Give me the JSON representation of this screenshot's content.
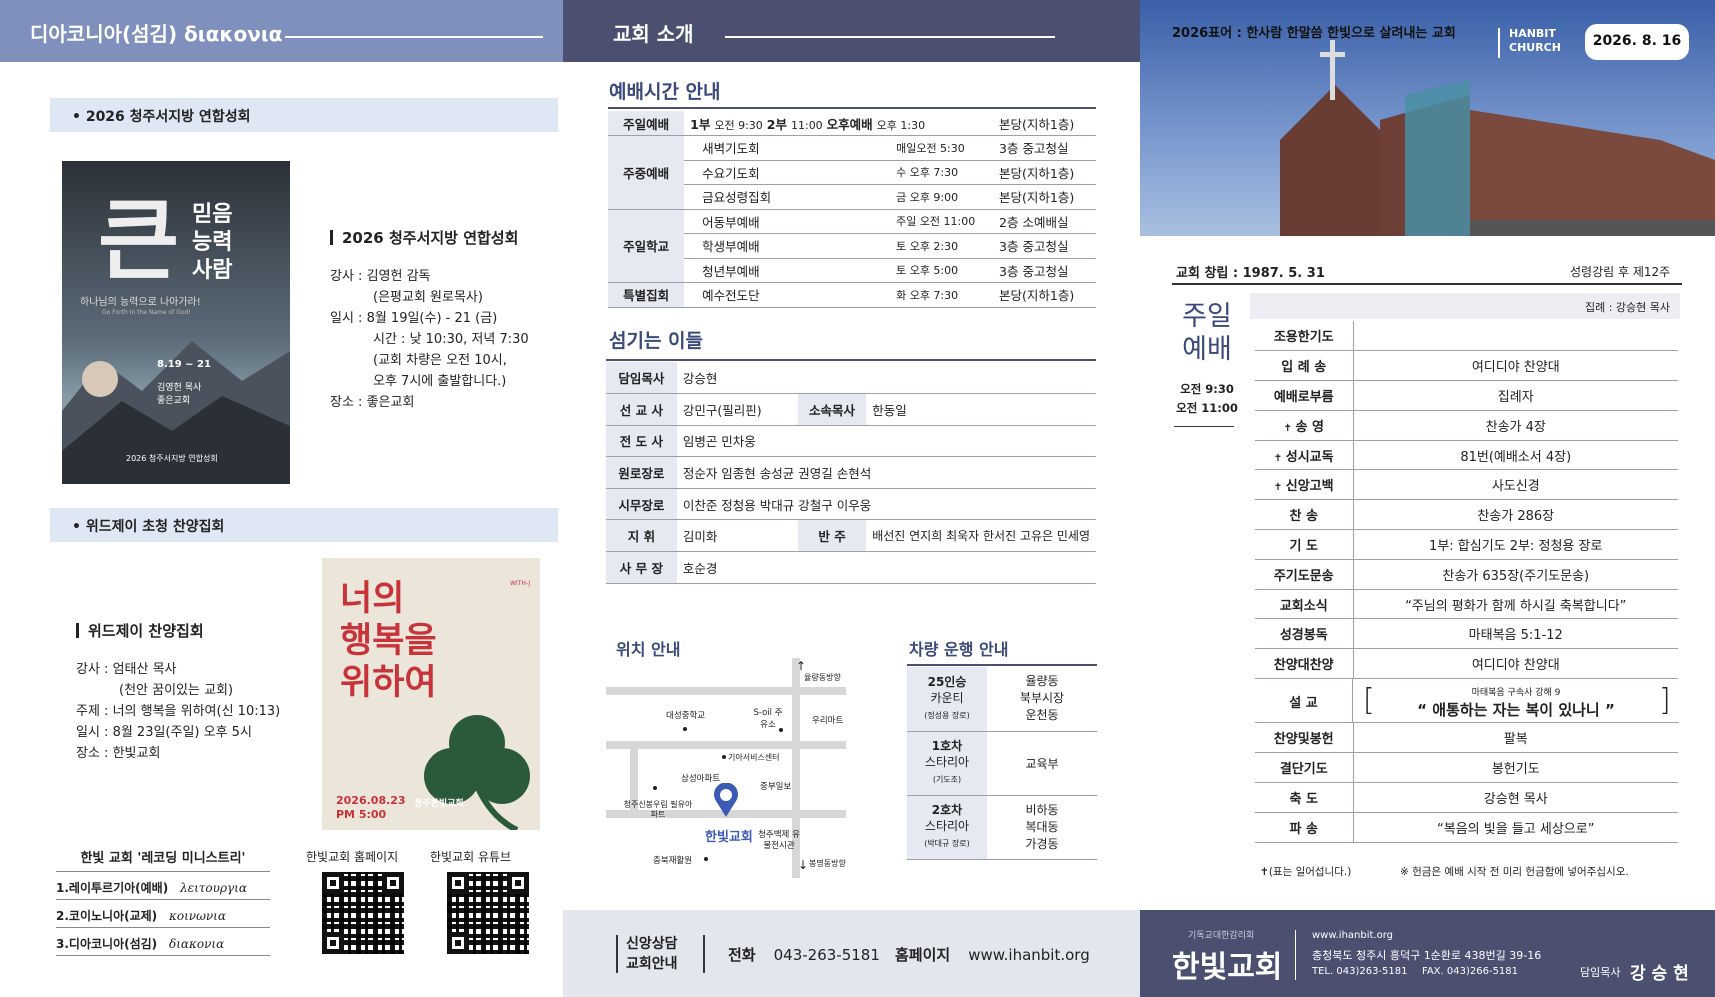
{
  "col1": {
    "header": "디아코니아(섬김) διακονια",
    "band1": "• 2026 청주서지방 연합성회",
    "poster1": {
      "big": "큰",
      "lines": [
        "믿음",
        "능력",
        "사람"
      ],
      "subtitle": "하나님의 능력으로 나아가라!",
      "english": "Go Forth In the Name of God!",
      "date": "8.19 ~ 21",
      "speaker": "김영헌 목사",
      "church": "좋은교회",
      "footer": "2026 청주서지방 연합성회"
    },
    "event1": {
      "title": "2026 청주서지방 연합성회",
      "lines": [
        "강사 : 김영헌 감독",
        "(은평교회 원로목사)",
        "일시 : 8월 19일(수) - 21 (금)",
        "시간 : 낮 10:30, 저녁 7:30",
        "(교회 차량은 오전 10시,",
        "오후 7시에 출발합니다.)",
        "장소 : 좋은교회"
      ]
    },
    "band2": "• 위드제이 초청 찬양집회",
    "event2": {
      "title": "위드제이 찬양집회",
      "lines": [
        "강사 : 엄태산 목사",
        "(천안 꿈이있는 교회)",
        "주제 : 너의 행복을 위하여(신 10:13)",
        "일시 : 8월 23일(주일) 오후 5시",
        "장소 : 한빛교회"
      ]
    },
    "poster2": {
      "title": [
        "너의",
        "행복을",
        "위하여"
      ],
      "date": "2026.08.23",
      "time": "PM 5:00",
      "church": "청주한빛교회",
      "badge": "WITH-J"
    },
    "ministry": {
      "title": "한빛 교회 '레코딩 미니스트리'",
      "items": [
        {
          "k": "1.레이투르기아(예배)",
          "g": "λειτουργια"
        },
        {
          "k": "2.코이노니아(교제)",
          "g": "κοινωνια"
        },
        {
          "k": "3.디아코니아(섬김)",
          "g": "διακονια"
        }
      ]
    },
    "qr1": "한빛교회 홈페이지",
    "qr2": "한빛교회 유튜브"
  },
  "col2": {
    "header": "교회 소개",
    "worship_title": "예배시간 안내",
    "worship": [
      {
        "g": "주일예배",
        "n": "",
        "t": "",
        "p": "본당(지하1층)",
        "inline": [
          "1부",
          "오전 9:30",
          "2부",
          "11:00",
          "오후예배",
          "오후 1:30"
        ]
      },
      {
        "g": "주중예배",
        "n": "새벽기도회",
        "t": "매일오전 5:30",
        "p": "3층 중고청실"
      },
      {
        "g": "",
        "n": "수요기도회",
        "t": "수 오후 7:30",
        "p": "본당(지하1층)"
      },
      {
        "g": "",
        "n": "금요성령집회",
        "t": "금 오후 9:00",
        "p": "본당(지하1층)"
      },
      {
        "g": "주일학교",
        "n": "어동부예배",
        "t": "주일 오전 11:00",
        "p": "2층 소예배실"
      },
      {
        "g": "",
        "n": "학생부예배",
        "t": "토 오후 2:30",
        "p": "3층 중고청실"
      },
      {
        "g": "",
        "n": "청년부예배",
        "t": "토 오후 5:00",
        "p": "3층 중고청실"
      },
      {
        "g": "특별집회",
        "n": "예수전도단",
        "t": "화 오후 7:30",
        "p": "본당(지하1층)"
      }
    ],
    "staff_title": "섬기는 이들",
    "staff": [
      {
        "l": "담임목사",
        "v": "강승현"
      },
      {
        "l": "선 교 사",
        "v": "강민구(필리핀)",
        "l2": "소속목사",
        "v2": "한동일"
      },
      {
        "l": "전 도 사",
        "v": "임병곤 민차웅"
      },
      {
        "l": "원로장로",
        "v": "정순자 임종현 송성균 권영길 손현석"
      },
      {
        "l": "시무장로",
        "v": "이찬준 정청용 박대규 강철구 이우웅"
      },
      {
        "l": "지 휘",
        "v": "김미화",
        "l2": "반 주",
        "v2": "배선진 연지희 최욱자 한서진 고유은 민세영"
      },
      {
        "l": "사 무 장",
        "v": "호순경"
      }
    ],
    "map_title": "위치 안내",
    "map_labels": {
      "north": "율량동방향",
      "south": "봉명동방향",
      "l1": "대성중학교",
      "l2": "S-oil 주유소",
      "l3": "우리마트",
      "l4": "기아서비스센터",
      "l5": "삼성아파트",
      "l6": "중부일보",
      "l7": "청주신봉우림 필유아파트",
      "l8": "한빛교회",
      "l9": "청주백제 유물전시관",
      "l10": "충북재활원"
    },
    "bus_title": "차량 운행 안내",
    "bus": [
      {
        "car": "25인승",
        "car2": "카운티",
        "drv": "(정성용 장로)",
        "area": [
          "율량동",
          "북부시장",
          "운천동"
        ]
      },
      {
        "car": "1호차",
        "car2": "스타리아",
        "drv": "(기도조)",
        "area": [
          "교육부"
        ]
      },
      {
        "car": "2호차",
        "car2": "스타리아",
        "drv": "(박대규 장로)",
        "area": [
          "비하동",
          "복대동",
          "가경동"
        ]
      }
    ],
    "footer": {
      "c1": "신앙상담",
      "c2": "교회안내",
      "tel_l": "전화",
      "tel": "043-263-5181",
      "web_l": "홈페이지",
      "web": "www.ihanbit.org"
    }
  },
  "col3": {
    "motto": "2026표어 : 한사람 한말씀 한빛으로 살려내는 교회",
    "brand": [
      "HANBIT",
      "CHURCH"
    ],
    "date": "2026. 8. 16",
    "founded": "교회 창립 : 1987. 5. 31",
    "week": "성령강림 후 제12주",
    "service_title": [
      "주일",
      "예배"
    ],
    "times": [
      "오전 9:30",
      "오전 11:00"
    ],
    "leader": "집례 : 강승현 목사",
    "order": [
      {
        "l": "조용한기도",
        "v": "",
        "s": false
      },
      {
        "l": "입 례 송",
        "v": "여디디야 찬양대",
        "s": false
      },
      {
        "l": "예배로부름",
        "v": "집례자",
        "s": false
      },
      {
        "l": "송 영",
        "v": "찬송가 4장",
        "s": true
      },
      {
        "l": "성시교독",
        "v": "81번(예배소서 4장)",
        "s": true
      },
      {
        "l": "신앙고백",
        "v": "사도신경",
        "s": true
      },
      {
        "l": "찬 송",
        "v": "찬송가 286장",
        "s": false
      },
      {
        "l": "기 도",
        "v": "1부: 합심기도 2부: 정청용 장로",
        "s": false
      },
      {
        "l": "주기도문송",
        "v": "찬송가 635장(주기도문송)",
        "s": false
      },
      {
        "l": "교회소식",
        "v": "“주님의 평화가 함께 하시길 축복합니다”",
        "s": false
      },
      {
        "l": "성경봉독",
        "v": "마태복음 5:1-12",
        "s": false
      },
      {
        "l": "찬양대찬양",
        "v": "여디디야 찬양대",
        "s": false
      }
    ],
    "sermon_label": "설 교",
    "sermon_ref": "마태복음 구속사 강해 9",
    "sermon": "“ 애통하는 자는 복이 있나니 ”",
    "order2": [
      {
        "l": "찬양및봉헌",
        "v": "팔복"
      },
      {
        "l": "결단기도",
        "v": "봉헌기도"
      },
      {
        "l": "축 도",
        "v": "강승현 목사"
      },
      {
        "l": "파 송",
        "v": "“복음의 빛을 들고 세상으로”"
      }
    ],
    "note1": "(표는 일어섭니다.)",
    "note2": "※ 헌금은 예배 시작 전 미리 헌금함에 넣어주십시오.",
    "footer": {
      "denom": "기독교대한감리회",
      "name": "한빛교회",
      "web": "www.ihanbit.org",
      "addr": "충청북도 청주시 흥덕구 1순환로 438번길 39-16",
      "tel": "TEL. 043)263-5181",
      "fax": "FAX. 043)266-5181",
      "pastor_l": "담임목사",
      "pastor": "강 승 현"
    }
  }
}
